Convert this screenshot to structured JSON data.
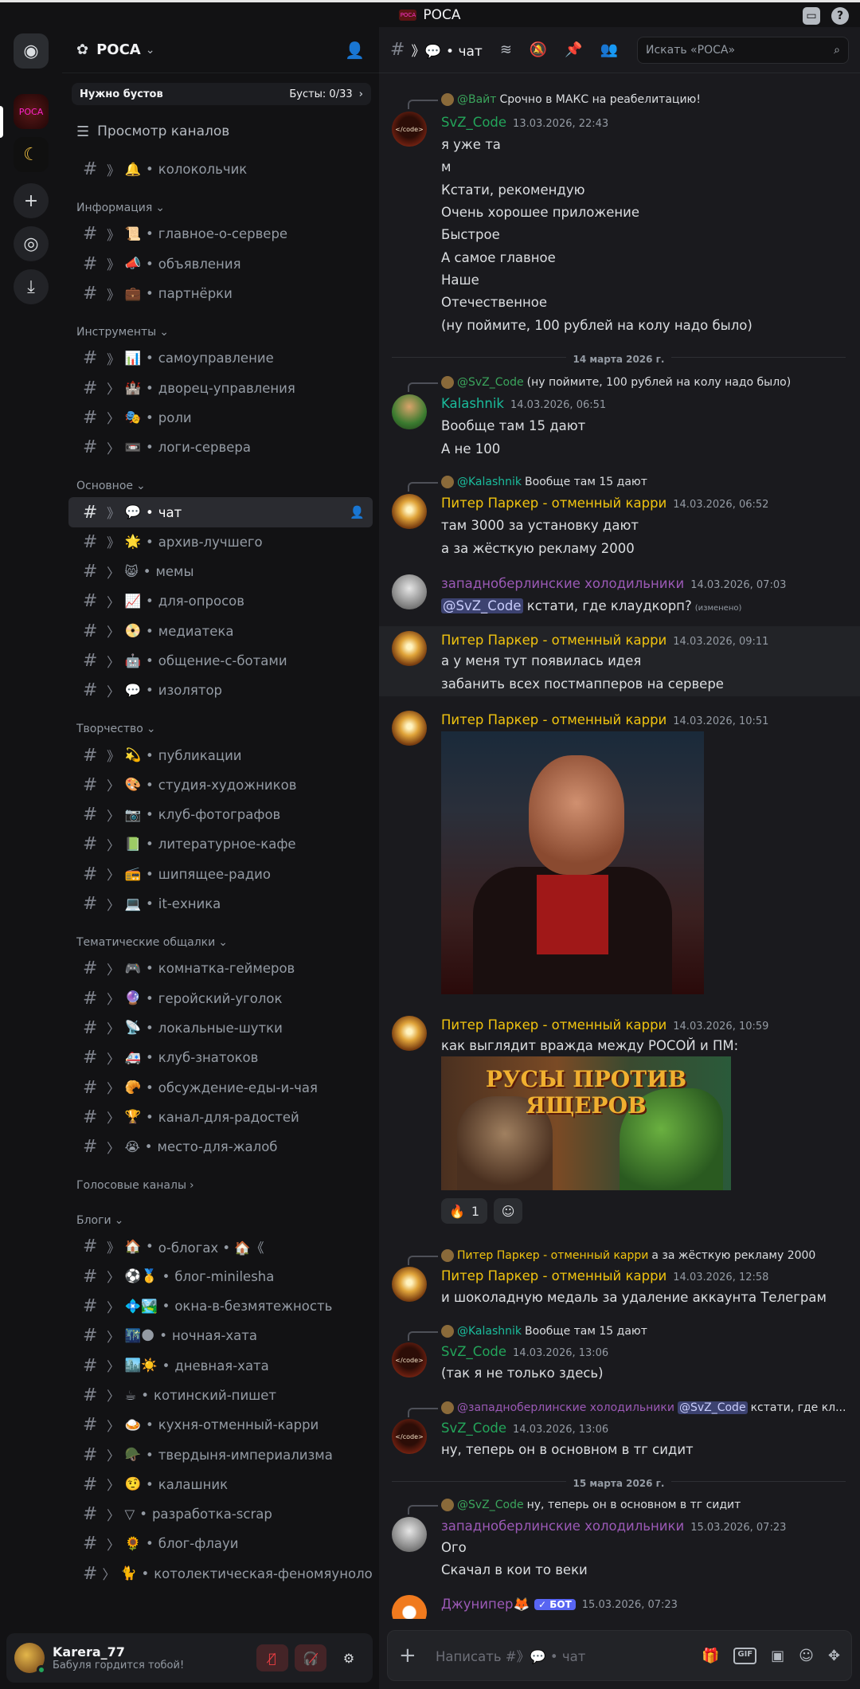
{
  "titlebar": {
    "title": "РОСА",
    "logo_text": "РОСА"
  },
  "guilds": [
    {
      "label": "Discord"
    },
    {
      "label": "РОСА"
    },
    {
      "label": "Server"
    },
    {
      "label": "+"
    },
    {
      "label": "Explore"
    },
    {
      "label": "Download"
    }
  ],
  "server": {
    "name": "РОСА",
    "boost_label": "Нужно бустов",
    "boost_count": "Бусты: 0/33",
    "browse": "Просмотр каналов"
  },
  "channels": {
    "top": [
      {
        "sym": "》",
        "emoji": "🔔",
        "name": "колокольчик"
      }
    ],
    "cat1": "Информация",
    "info": [
      {
        "sym": "》",
        "emoji": "📜",
        "name": "главное-о-сервере"
      },
      {
        "sym": "》",
        "emoji": "📣",
        "name": "объявления"
      },
      {
        "sym": "》",
        "emoji": "💼",
        "name": "партнёрки"
      }
    ],
    "cat2": "Инструменты",
    "tools": [
      {
        "sym": "》",
        "emoji": "📊",
        "name": "самоуправление"
      },
      {
        "sym": "〉",
        "emoji": "🏰",
        "name": "дворец-управления"
      },
      {
        "sym": "〉",
        "emoji": "🎭",
        "name": "роли"
      },
      {
        "sym": "〉",
        "emoji": "📼",
        "name": "логи-сервера"
      }
    ],
    "cat3": "Основное",
    "main": [
      {
        "sym": "》",
        "emoji": "💬",
        "name": "чат"
      },
      {
        "sym": "》",
        "emoji": "🌟",
        "name": "архив-лучшего"
      },
      {
        "sym": "〉",
        "emoji": "😸",
        "name": "мемы"
      },
      {
        "sym": "〉",
        "emoji": "📈",
        "name": "для-опросов"
      },
      {
        "sym": "〉",
        "emoji": "📀",
        "name": "медиатека"
      },
      {
        "sym": "〉",
        "emoji": "🤖",
        "name": "общение-с-ботами"
      },
      {
        "sym": "〉",
        "emoji": "💬",
        "name": "изолятор"
      }
    ],
    "cat4": "Творчество",
    "creative": [
      {
        "sym": "》",
        "emoji": "💫",
        "name": "публикации"
      },
      {
        "sym": "〉",
        "emoji": "🎨",
        "name": "студия-художников"
      },
      {
        "sym": "〉",
        "emoji": "📷",
        "name": "клуб-фотографов"
      },
      {
        "sym": "〉",
        "emoji": "📗",
        "name": "литературное-кафе"
      },
      {
        "sym": "〉",
        "emoji": "📻",
        "name": "шипящее-радио"
      },
      {
        "sym": "〉",
        "emoji": "💻",
        "name": "it-ехника"
      }
    ],
    "cat5": "Тематические общалки",
    "themed": [
      {
        "sym": "〉",
        "emoji": "🎮",
        "name": "комнатка-геймеров"
      },
      {
        "sym": "〉",
        "emoji": "🔮",
        "name": "геройский-уголок"
      },
      {
        "sym": "〉",
        "emoji": "📡",
        "name": "локальные-шутки"
      },
      {
        "sym": "〉",
        "emoji": "🚑",
        "name": "клуб-знатоков"
      },
      {
        "sym": "〉",
        "emoji": "🥐",
        "name": "обсуждение-еды-и-чая"
      },
      {
        "sym": "〉",
        "emoji": "🏆",
        "name": "канал-для-радостей"
      },
      {
        "sym": "〉",
        "emoji": "😭",
        "name": "место-для-жалоб"
      }
    ],
    "cat6": "Голосовые каналы",
    "cat7": "Блоги",
    "blogs": [
      {
        "sym": "》",
        "emoji": "🏠",
        "name": "о-блогах • 🏠《"
      },
      {
        "sym": "〉",
        "emoji": "⚽🥇",
        "name": "блог-minilesha"
      },
      {
        "sym": "〉",
        "emoji": "💠🏞️",
        "name": "окна-в-безмятежность"
      },
      {
        "sym": "〉",
        "emoji": "🌃🌑",
        "name": "ночная-хата"
      },
      {
        "sym": "〉",
        "emoji": "🏙️☀️",
        "name": "дневная-хата"
      },
      {
        "sym": "〉",
        "emoji": "☕",
        "name": "котинский-пишет"
      },
      {
        "sym": "〉",
        "emoji": "🍛",
        "name": "кухня-отменный-карри"
      },
      {
        "sym": "〉",
        "emoji": "🪖",
        "name": "твердыня-империализма"
      },
      {
        "sym": "〉",
        "emoji": "🤨",
        "name": "калашник"
      },
      {
        "sym": "〉",
        "emoji": "▽",
        "name": "разработка-scrap"
      },
      {
        "sym": "〉",
        "emoji": "🌻",
        "name": "блог-флауи"
      },
      {
        "sym": "〉",
        "emoji": "🐈",
        "name": "котолектическая-феномяуноло..."
      }
    ]
  },
  "user": {
    "name": "Karera_77",
    "status": "Бабуля гордится тобой!"
  },
  "topbar": {
    "hash": "#",
    "channel": "》💬 • чат",
    "search_placeholder": "Искать «РОСА»"
  },
  "messages": {
    "m1": {
      "reply_mention": "@Вайт",
      "reply_text": "Срочно в МАКС на реабелитацию!",
      "author": "SvZ_Code",
      "time": "13.03.2026, 22:43",
      "lines": [
        "я уже та",
        "м",
        "Кстати, рекомендую",
        "Очень хорошее приложение",
        "Быстрое",
        "А самое главное",
        "Наше",
        "Отечественное",
        "(ну поймите, 100 рублей на колу надо было)"
      ]
    },
    "d1": "14 марта 2026 г.",
    "m2": {
      "reply_mention": "@SvZ_Code",
      "reply_text": "(ну поймите, 100 рублей на колу надо было)",
      "author": "Kalashnik",
      "time": "14.03.2026, 06:51",
      "lines": [
        "Вообще там 15 дают",
        "А не 100"
      ]
    },
    "m3": {
      "reply_mention": "@Kalashnik",
      "reply_text": "Вообще там 15 дают",
      "author": "Питер Паркер - отменный карри",
      "time": "14.03.2026, 06:52",
      "lines": [
        "там 3000 за установку дают",
        "а за жёсткую рекламу 2000"
      ]
    },
    "m4": {
      "author": "западноберлинские холодильники",
      "time": "14.03.2026, 07:03",
      "mention": "@SvZ_Code",
      "text": " кстати, где клаудкорп?",
      "edited": "(изменено)"
    },
    "m5": {
      "author": "Питер Паркер - отменный карри",
      "time": "14.03.2026, 09:11",
      "lines": [
        "а у меня тут появилась идея",
        "забанить всех постмапперов на сервере"
      ]
    },
    "m6": {
      "author": "Питер Паркер - отменный карри",
      "time": "14.03.2026, 10:51"
    },
    "m7": {
      "author": "Питер Паркер - отменный карри",
      "time": "14.03.2026, 10:59",
      "text": "как выглядит вражда между РОСОЙ и ПМ:",
      "image_title": "РУСЫ ПРОТИВ ЯЩЕРОВ",
      "reaction_emoji": "🔥",
      "reaction_count": "1"
    },
    "m8": {
      "reply_name": "Питер Паркер - отменный карри",
      "reply_text": "а за жёсткую рекламу 2000",
      "author": "Питер Паркер - отменный карри",
      "time": "14.03.2026, 12:58",
      "text": "и шоколадную медаль за удаление аккаунта Телеграм"
    },
    "m9": {
      "reply_mention": "@Kalashnik",
      "reply_text": "Вообще там 15 дают",
      "author": "SvZ_Code",
      "time": "14.03.2026, 13:06",
      "text": "(так я не только здесь)"
    },
    "m10": {
      "reply_mention": "@западноберлинские холодильники",
      "reply_mention2": "@SvZ_Code",
      "reply_text": "кстати, где кл...",
      "author": "SvZ_Code",
      "time": "14.03.2026, 13:06",
      "text": "ну, теперь он в основном в тг сидит"
    },
    "d2": "15 марта 2026 г.",
    "m11": {
      "reply_mention": "@SvZ_Code",
      "reply_text": "ну, теперь он в основном в тг сидит",
      "author": "западноберлинские холодильники",
      "time": "15.03.2026, 07:23",
      "lines": [
        "Ого",
        "Скачал в кои то веки"
      ]
    },
    "m12": {
      "author": "Джунипер🦊",
      "bot": "✓ БОТ",
      "time": "15.03.2026, 07:23"
    }
  },
  "composer": {
    "placeholder": "Написать #》💬 • чат"
  },
  "colors": {
    "code": "#23a55a",
    "kalashnik": "#1abc9c",
    "piter": "#f1c40f",
    "zap": "#9b59b6",
    "bot": "#5865f2"
  }
}
